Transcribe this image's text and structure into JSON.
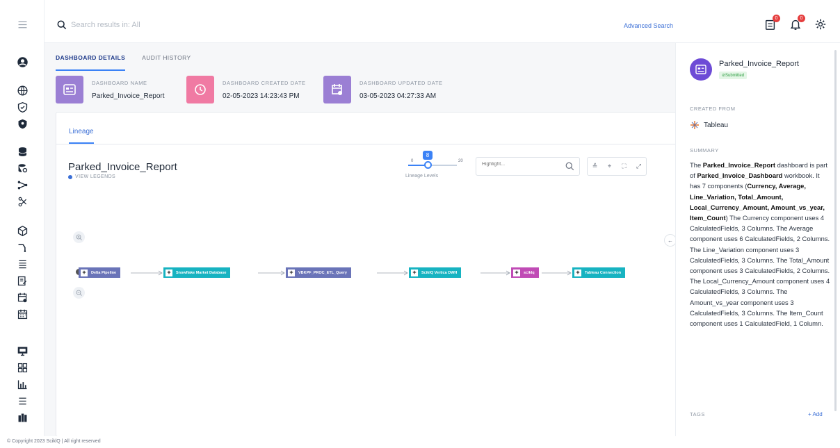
{
  "search": {
    "placeholder": "Search results in: All",
    "advanced_label": "Advanced Search"
  },
  "top_icons": [
    {
      "name": "reports-icon",
      "badge": "0"
    },
    {
      "name": "bell-icon",
      "badge": "0"
    },
    {
      "name": "gear-icon"
    }
  ],
  "tabs": [
    {
      "label": "DASHBOARD DETAILS",
      "active": true
    },
    {
      "label": "AUDIT HISTORY",
      "active": false
    }
  ],
  "info_cards": [
    {
      "label": "DASHBOARD NAME",
      "value": "Parked_Invoice_Report",
      "color": "#9b7fd4"
    },
    {
      "label": "DASHBOARD CREATED DATE",
      "value": "02-05-2023 14:23:43 PM",
      "color": "#f07aa3"
    },
    {
      "label": "DASHBOARD UPDATED DATE",
      "value": "03-05-2023 04:27:33 AM",
      "color": "#9b7fd4"
    }
  ],
  "lineage": {
    "tab_label": "Lineage",
    "title": "Parked_Invoice_Report",
    "legend_label": "VIEW LEGENDS",
    "slider": {
      "min": "0",
      "max": "20",
      "value": "8",
      "fraction": 0.4,
      "caption": "Lineage Levels"
    },
    "highlight_placeholder": "Highlight...",
    "nodes": [
      {
        "label": "Delta Pipeline",
        "color": "#6a74b8"
      },
      {
        "label": "Snowflake Market Database",
        "color": "#17b3c1"
      },
      {
        "label": "VBKPF_PROC_ETL_Query",
        "color": "#6a74b8"
      },
      {
        "label": "SciklQ Vertica DWH",
        "color": "#17b3c1"
      },
      {
        "label": "sciklq",
        "color": "#c04bb5"
      },
      {
        "label": "Tableau Connection",
        "color": "#17b3c1"
      }
    ]
  },
  "right_panel": {
    "name": "Parked_Invoice_Report",
    "status": "⊘Submitted",
    "created_from_label": "CREATED FROM",
    "source": "Tableau",
    "summary_label": "SUMMARY",
    "summary_parts": [
      {
        "t": "The ",
        "b": false
      },
      {
        "t": "Parked_Invoice_Report",
        "b": true
      },
      {
        "t": " dashboard is part of ",
        "b": false
      },
      {
        "t": "Parked_Invoice_Dashboard",
        "b": true
      },
      {
        "t": " workbook. It has 7 components (",
        "b": false
      },
      {
        "t": "Currency, Average, Line_Variation, Total_Amount, Local_Currency_Amount, Amount_vs_year, Item_Count",
        "b": true
      },
      {
        "t": ") The Currency component uses 4 CalculatedFields, 3 Columns. The Average component uses 6 CalculatedFields, 2 Columns. The Line_Variation component uses 3 CalculatedFields, 3 Columns. The Total_Amount component uses 3 CalculatedFields, 2 Columns. The Local_Currency_Amount component uses 4 CalculatedFields, 3 Columns. The Amount_vs_year component uses 3 CalculatedFields, 3 Columns. The Item_Count component uses 1 CalculatedField, 1 Column.",
        "b": false
      }
    ],
    "tags_label": "TAGS",
    "add_label": "+ Add"
  },
  "footer": "© Copyright 2023 SciklQ | All right reserved"
}
